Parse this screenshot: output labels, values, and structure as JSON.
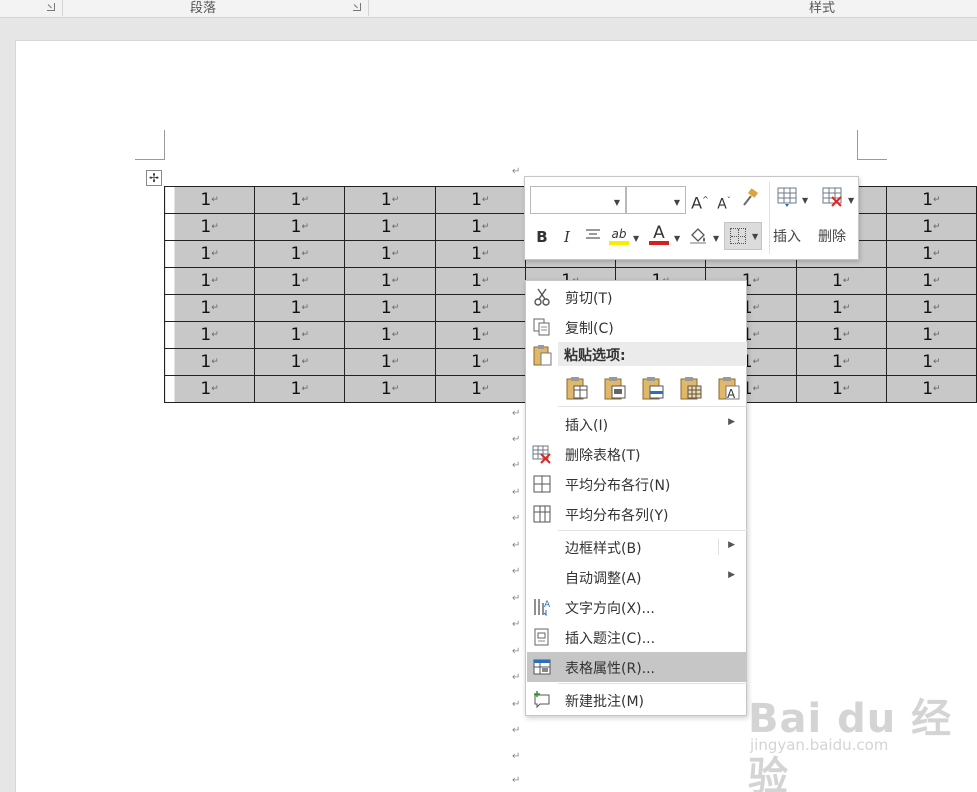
{
  "ribbon": {
    "paragraph_group": "段落",
    "styles_group": "样式"
  },
  "table": {
    "rows": 8,
    "cols": 9,
    "cell_value": "1",
    "cell_mark": "↵"
  },
  "paragraph_mark": "↵",
  "mini_toolbar": {
    "font_name": "",
    "font_size": "",
    "grow_font": "A",
    "shrink_font": "A",
    "bold": "B",
    "italic": "I",
    "highlight": "ab",
    "font_color": "A",
    "insert_label": "插入",
    "delete_label": "删除"
  },
  "context_menu": {
    "cut": "剪切(T)",
    "copy": "复制(C)",
    "paste_options": "粘贴选项:",
    "insert": "插入(I)",
    "delete_table": "删除表格(T)",
    "distribute_rows": "平均分布各行(N)",
    "distribute_cols": "平均分布各列(Y)",
    "border_styles": "边框样式(B)",
    "autofit": "自动调整(A)",
    "text_direction": "文字方向(X)...",
    "insert_caption": "插入题注(C)...",
    "table_properties": "表格属性(R)...",
    "new_comment": "新建批注(M)"
  },
  "colors": {
    "highlight_color": "#f5ef00",
    "font_color": "#d81e1e",
    "cell_shading": "#c8c8c8",
    "menu_highlight": "#c6c6c6"
  },
  "watermark": {
    "logo": "Bai du 经验",
    "url": "jingyan.baidu.com"
  }
}
